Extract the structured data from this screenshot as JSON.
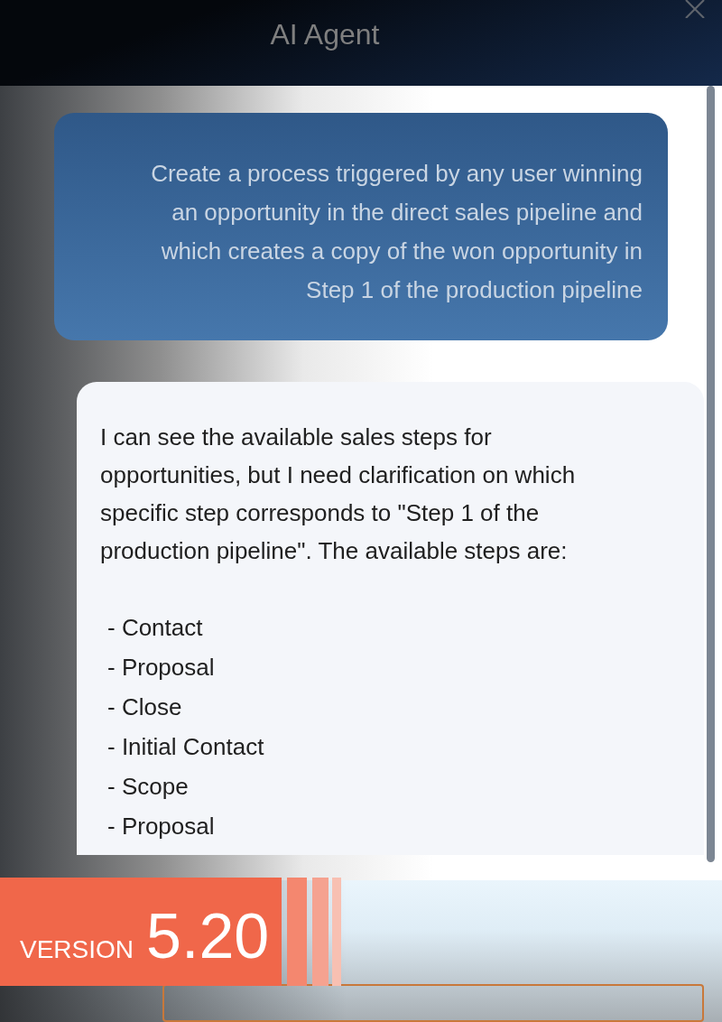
{
  "window": {
    "title": "AI Agent"
  },
  "messages": [
    {
      "kind": "user",
      "text": "Create a process triggered by any user winning an opportunity in the direct sales pipeline and which creates a copy of the won opportunity in Step 1 of the production pipeline"
    },
    {
      "kind": "assistant",
      "text": "I can see the available sales steps for opportunities, but I need clarification on which specific step corresponds to \"Step 1 of the production pipeline\". The available steps are:",
      "list": [
        "- Contact",
        "- Proposal",
        "- Close",
        "- Initial Contact",
        "- Scope",
        "- Proposal"
      ]
    }
  ],
  "banner": {
    "label": "VERSION",
    "version": "5.20"
  }
}
